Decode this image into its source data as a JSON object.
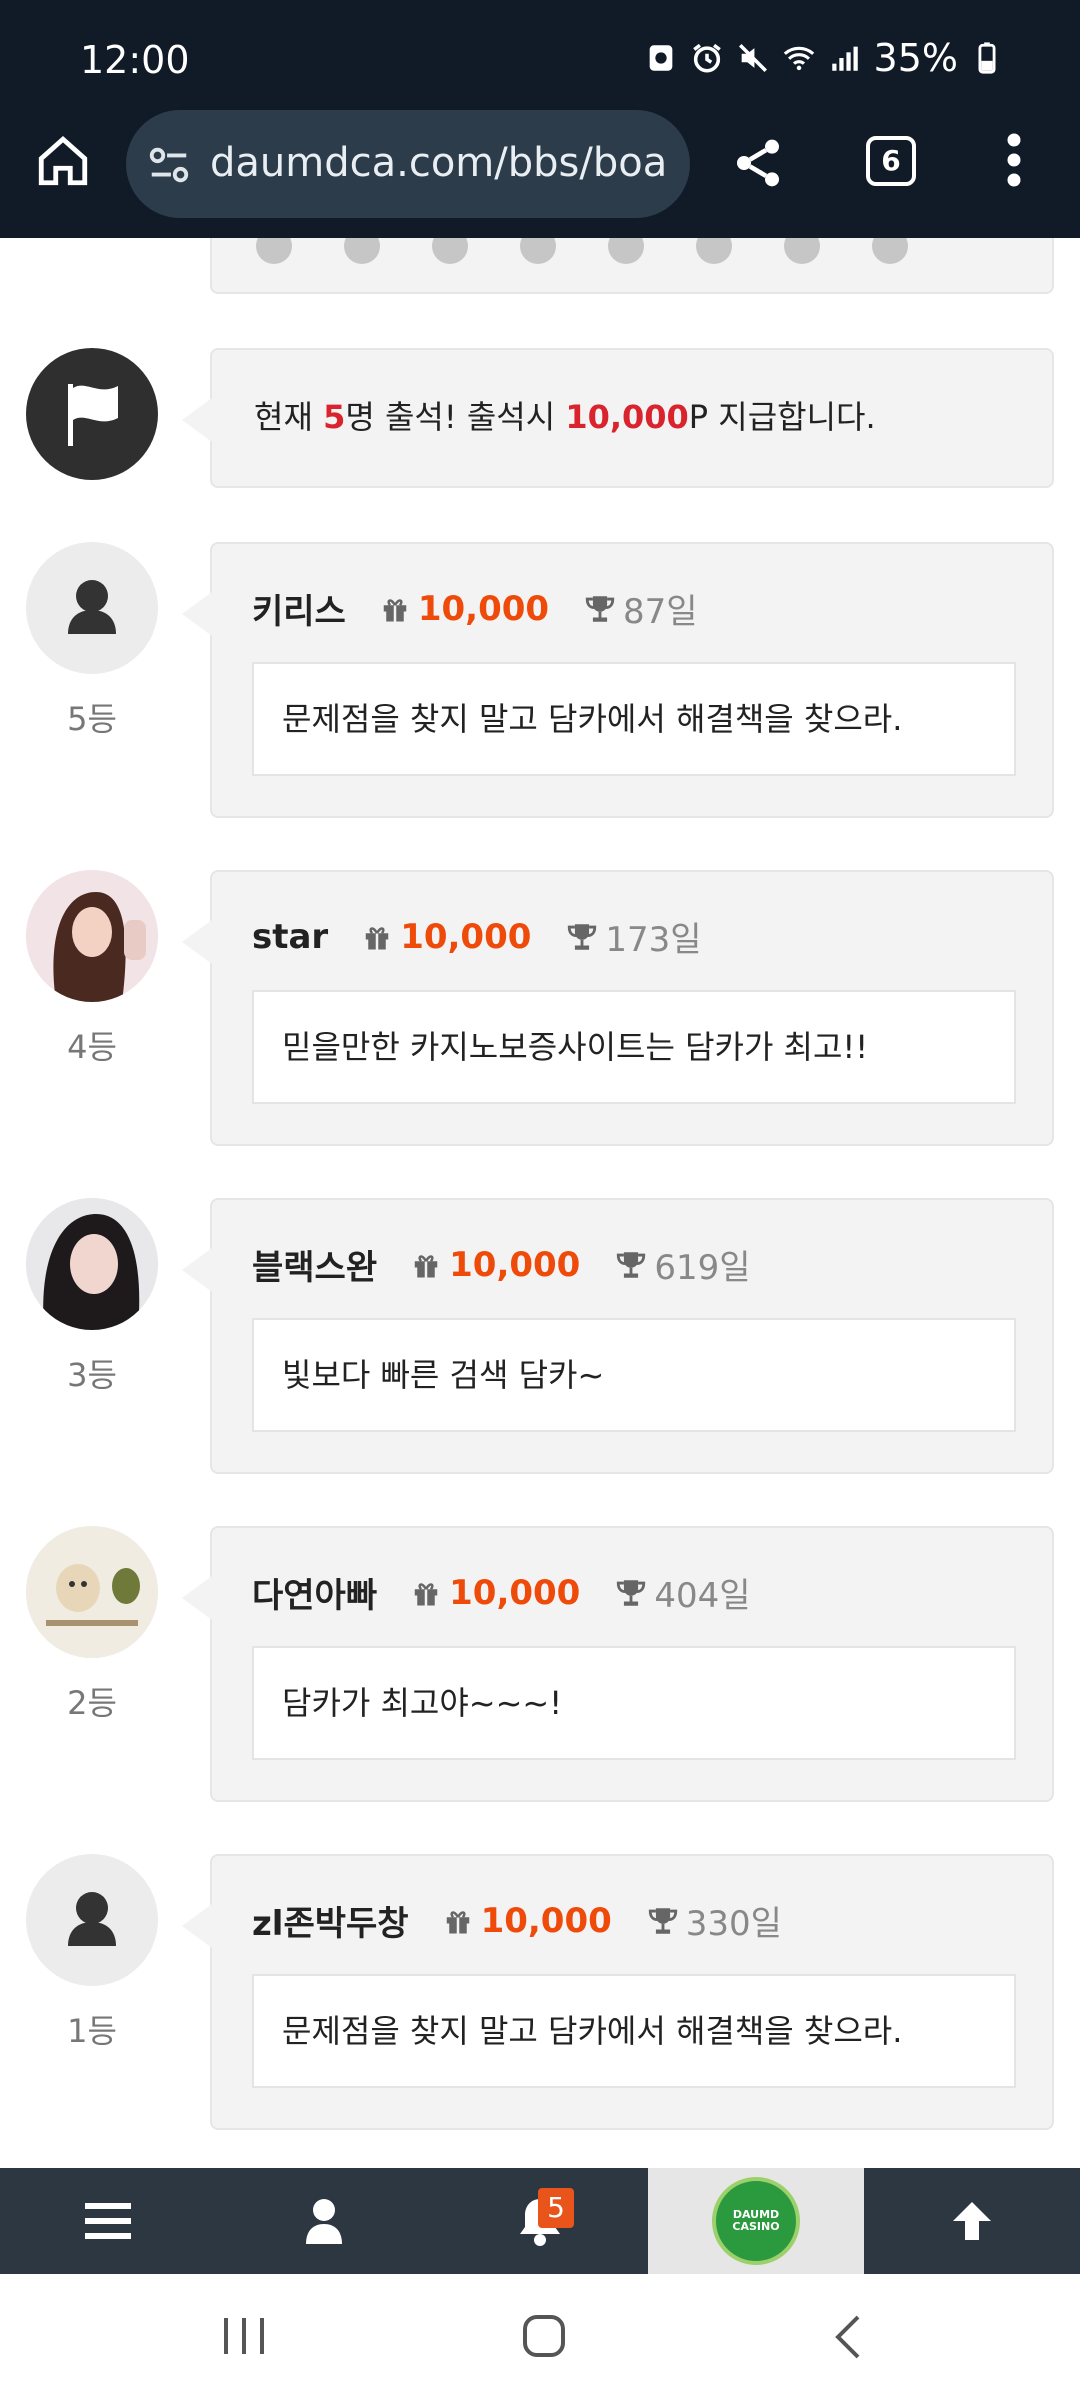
{
  "status": {
    "time": "12:00",
    "battery": "35%"
  },
  "browser": {
    "url": "daumdca.com/bbs/boa",
    "tab_count": "6"
  },
  "notice": {
    "pre": "현재 ",
    "count": "5",
    "mid": "명 출석! 출석시 ",
    "points": "10,000",
    "post": "P 지급합니다."
  },
  "entries": [
    {
      "nick": "키리스",
      "points": "10,000",
      "days": "87일",
      "message": "문제점을 찾지 말고 담카에서 해결책을 찾으라.",
      "rank": "5등",
      "avatar": "default"
    },
    {
      "nick": "star",
      "points": "10,000",
      "days": "173일",
      "message": "믿을만한 카지노보증사이트는 담카가 최고!!",
      "rank": "4등",
      "avatar": "photo"
    },
    {
      "nick": "블랙스완",
      "points": "10,000",
      "days": "619일",
      "message": "빛보다 빠른 검색 담카~",
      "rank": "3등",
      "avatar": "photo"
    },
    {
      "nick": "다연아빠",
      "points": "10,000",
      "days": "404일",
      "message": "담카가 최고야~~~!",
      "rank": "2등",
      "avatar": "photo"
    },
    {
      "nick": "zl존박두창",
      "points": "10,000",
      "days": "330일",
      "message": "문제점을 찾지 말고 담카에서 해결책을 찾으라.",
      "rank": "1등",
      "avatar": "default"
    }
  ],
  "bottom_nav": {
    "notification_count": "5",
    "logo_text": "DAUMD CASINO"
  },
  "colors": {
    "accent": "#ee4a0a",
    "red": "#d9232d",
    "statusbar": "#111b27",
    "nav": "#2d3742"
  }
}
